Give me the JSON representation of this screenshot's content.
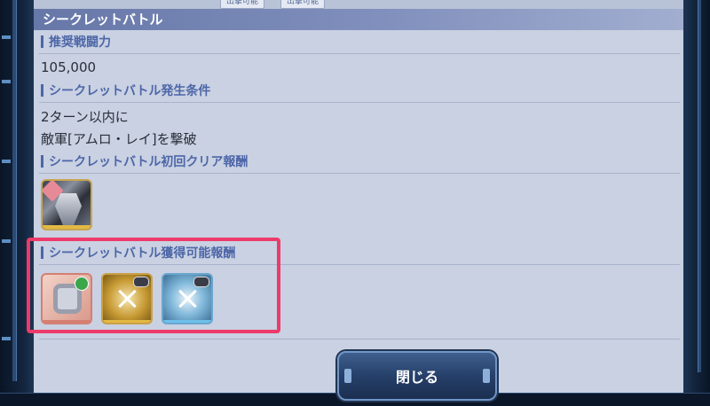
{
  "top_tags": [
    "出撃可能",
    "出撃可能"
  ],
  "dialog": {
    "title": "シークレットバトル"
  },
  "sections": {
    "recommended_power": {
      "label": "推奨戦闘力",
      "value": "105,000"
    },
    "condition": {
      "label": "シークレットバトル発生条件",
      "line1": "2ターン以内に",
      "line2": "敵軍[アムロ・レイ]を撃破"
    },
    "first_clear_reward": {
      "label": "シークレットバトル初回クリア報酬",
      "items": [
        "gundam-unit-icon"
      ]
    },
    "obtainable_reward": {
      "label": "シークレットバトル獲得可能報酬",
      "items": [
        "g-part-icon",
        "gold-chip-icon",
        "blue-chip-icon"
      ]
    }
  },
  "buttons": {
    "close_label": "閉じる"
  },
  "colors": {
    "title_bar": "#7788b5",
    "section_label": "#4d66a8",
    "highlight_border": "#ee3a6a",
    "panel_bg": "#c9d1e2"
  }
}
